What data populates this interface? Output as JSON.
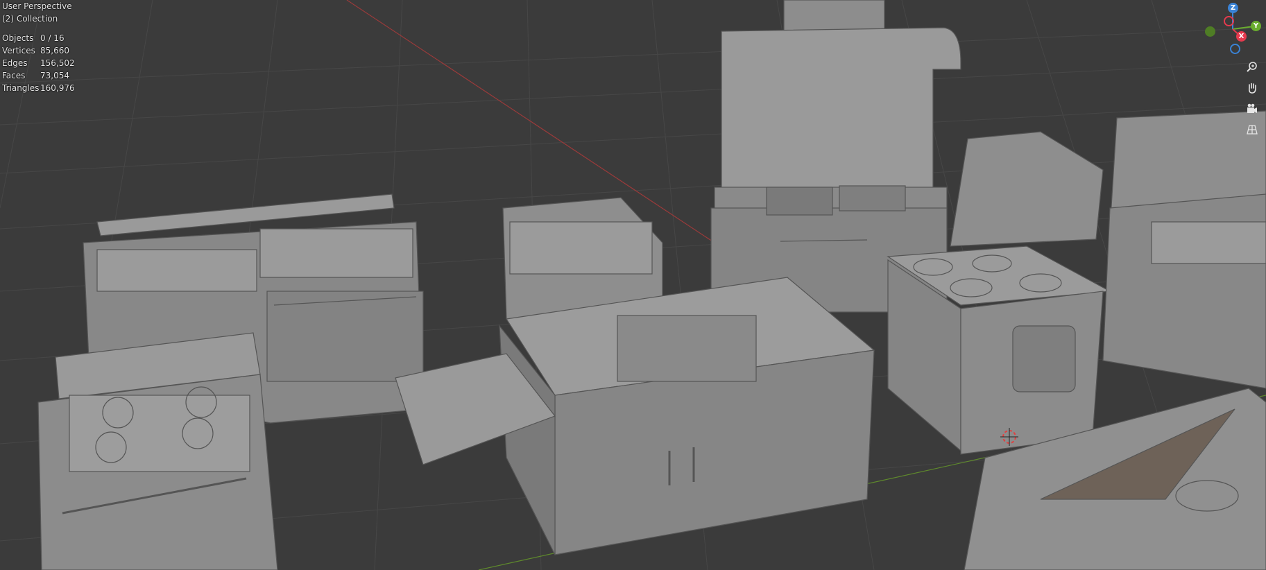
{
  "overlay": {
    "view_mode": "User Perspective",
    "collection": "(2) Collection",
    "stats": [
      {
        "label": "Objects",
        "value": "0 / 16"
      },
      {
        "label": "Vertices",
        "value": "85,660"
      },
      {
        "label": "Edges",
        "value": "156,502"
      },
      {
        "label": "Faces",
        "value": "73,054"
      },
      {
        "label": "Triangles",
        "value": "160,976"
      }
    ]
  },
  "gizmo": {
    "z_label": "Z",
    "y_label": "Y",
    "x_label": "X",
    "colors": {
      "x": "#e53a4e",
      "y": "#6aad2f",
      "z": "#3a83d6"
    }
  },
  "nav_buttons": [
    {
      "icon": "zoom-icon"
    },
    {
      "icon": "pan-hand-icon"
    },
    {
      "icon": "camera-icon"
    },
    {
      "icon": "grid-ortho-icon"
    }
  ],
  "colors": {
    "background": "#3b3b3b",
    "grid": "#454545",
    "model": "#8c8c8c"
  }
}
